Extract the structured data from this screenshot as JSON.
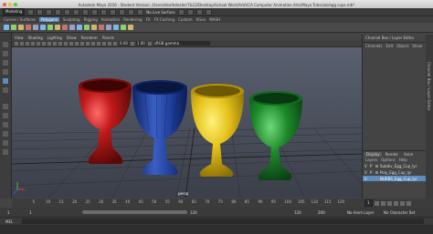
{
  "window": {
    "title": "Autodesk Maya 2016 - Student Version: /Users/dealhdealer/7&12/Desktop/School Work/Art/UCA Computer Animation Arts/Maya Tutorials/egg cups.mb*"
  },
  "status_line": {
    "mode": "Modeling",
    "live_surface": "No Live Surface"
  },
  "shelf": {
    "tabs": [
      "Curves / Surfaces",
      "Polygons",
      "Sculpting",
      "Rigging",
      "Animation",
      "Rendering",
      "FX",
      "FX Caching",
      "Custom",
      "XGen",
      "MASH"
    ],
    "active_tab": "Polygons",
    "icon_colors": [
      "#7db7e8",
      "#8bd06b",
      "#d0b56b",
      "#c87070",
      "#9aa0c8",
      "#7db7e8",
      "#8bd06b",
      "#d0b56b",
      "#c87070",
      "#9aa0c8",
      "#7db7e8",
      "#8bd06b",
      "#d0b56b",
      "#c87070",
      "#9aa0c8",
      "#7db7e8",
      "#8bd06b",
      "#d0b56b"
    ]
  },
  "panel": {
    "menus": [
      "View",
      "Shading",
      "Lighting",
      "Show",
      "Renderer",
      "Panels"
    ],
    "exposure": "0.00",
    "gamma": "1.00",
    "color_space": "sRGB gamma",
    "camera_label": "persp"
  },
  "channel_box": {
    "title": "Channel Box / Layer Editor",
    "menus": [
      "Channels",
      "Edit",
      "Object",
      "Show"
    ]
  },
  "layers": {
    "tabs": [
      "Display",
      "Render",
      "Anim"
    ],
    "active_tab": "Display",
    "menus": [
      "Layers",
      "Options",
      "Help"
    ],
    "rows": [
      {
        "v": "V",
        "p": "P",
        "name": "Subdiv_Egg_Cup_lyr",
        "selected": false
      },
      {
        "v": "V",
        "p": "P",
        "name": "Poly_Egg_Cup_lyr",
        "selected": false
      },
      {
        "v": "V",
        "p": "",
        "name": "NURBS_Egg_Cup_lyr",
        "selected": true
      }
    ]
  },
  "side_tab": "Channel Box / Layer Editor",
  "timeline": {
    "ticks": [
      "5",
      "10",
      "15",
      "20",
      "25",
      "30",
      "35",
      "40",
      "45",
      "50",
      "55",
      "60",
      "65",
      "70",
      "75",
      "80",
      "85",
      "90",
      "95",
      "100",
      "105",
      "110",
      "115",
      "120"
    ],
    "current_frame": "1",
    "current_frame_right": "1"
  },
  "range": {
    "start": "1",
    "inner_start": "1",
    "inner_end": "120",
    "end1": "120",
    "end2": "200",
    "anim_layer": "No Anim Layer",
    "char_set": "No Character Set"
  },
  "command": {
    "label": "MEL"
  },
  "cups": [
    {
      "name": "red",
      "color": "#c21a1a"
    },
    {
      "name": "blue",
      "color": "#1f3f9a"
    },
    {
      "name": "yellow",
      "color": "#e6c21a"
    },
    {
      "name": "green",
      "color": "#1d8a2a"
    }
  ]
}
